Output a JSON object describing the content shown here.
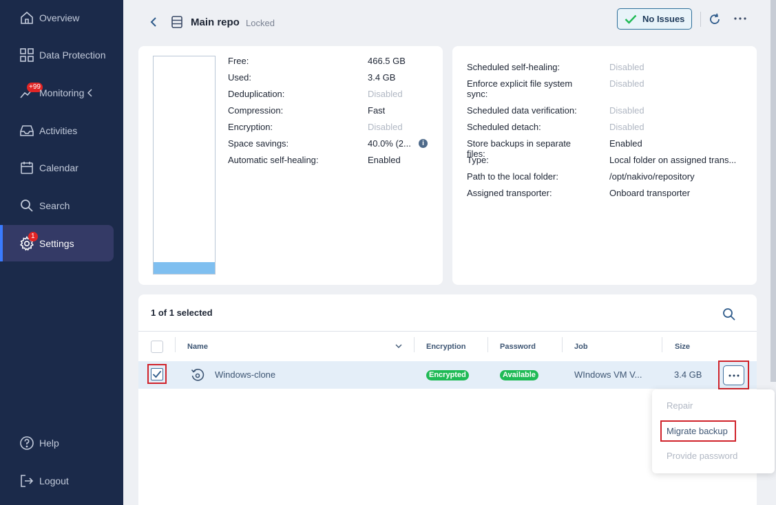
{
  "sidebar": {
    "items": [
      {
        "label": "Overview",
        "icon": "home-icon"
      },
      {
        "label": "Data Protection",
        "icon": "grid-icon"
      },
      {
        "label": "Monitoring",
        "icon": "chart-icon",
        "badge": "+99"
      },
      {
        "label": "Activities",
        "icon": "inbox-icon"
      },
      {
        "label": "Calendar",
        "icon": "calendar-icon"
      },
      {
        "label": "Search",
        "icon": "search-icon"
      },
      {
        "label": "Settings",
        "icon": "gear-icon",
        "badge": "1",
        "active": true
      },
      {
        "label": "Help",
        "icon": "help-icon"
      },
      {
        "label": "Logout",
        "icon": "logout-icon"
      }
    ]
  },
  "header": {
    "title": "Main repo",
    "status": "Locked",
    "issues_label": "No Issues"
  },
  "summary": {
    "usage_fraction": 0.055,
    "rows": [
      {
        "label": "Free:",
        "value": "466.5 GB",
        "disabled": false
      },
      {
        "label": "Used:",
        "value": "3.4 GB",
        "disabled": false
      },
      {
        "label": "Deduplication:",
        "value": "Disabled",
        "disabled": true
      },
      {
        "label": "Compression:",
        "value": "Fast",
        "disabled": false
      },
      {
        "label": "Encryption:",
        "value": "Disabled",
        "disabled": true
      },
      {
        "label": "Space savings:",
        "value": "40.0% (2...",
        "disabled": false
      },
      {
        "label": "Automatic self-healing:",
        "value": "Enabled",
        "disabled": false
      }
    ]
  },
  "details": {
    "rows": [
      {
        "label": "Scheduled self-healing:",
        "value": "Disabled",
        "disabled": true
      },
      {
        "label": "Enforce explicit file system sync:",
        "value": "Disabled",
        "disabled": true
      },
      {
        "label": "Scheduled data verification:",
        "value": "Disabled",
        "disabled": true
      },
      {
        "label": "Scheduled detach:",
        "value": "Disabled",
        "disabled": true
      },
      {
        "label": "Store backups in separate files:",
        "value": "Enabled",
        "disabled": false
      },
      {
        "label": "Type:",
        "value": "Local folder on assigned trans...",
        "disabled": false
      },
      {
        "label": "Path to the local folder:",
        "value": "/opt/nakivo/repository",
        "disabled": false
      },
      {
        "label": "Assigned transporter:",
        "value": "Onboard transporter",
        "disabled": false
      }
    ]
  },
  "table": {
    "selection_text": "1 of 1 selected",
    "columns": {
      "name": "Name",
      "encryption": "Encryption",
      "password": "Password",
      "job": "Job",
      "size": "Size"
    },
    "rows": [
      {
        "name": "Windows-clone",
        "encryption": "Encrypted",
        "password": "Available",
        "job": "WIndows VM V...",
        "size": "3.4 GB",
        "selected": true
      }
    ]
  },
  "context_menu": {
    "items": [
      {
        "label": "Repair",
        "enabled": false
      },
      {
        "label": "Migrate backup",
        "enabled": true
      },
      {
        "label": "Provide password",
        "enabled": false
      }
    ]
  },
  "colors": {
    "sidebar_bg": "#1b2a4a",
    "active_item_bg": "#343a66",
    "accent": "#3a7bff",
    "success_pill": "#1fba55",
    "highlight_border": "#d0222a"
  }
}
